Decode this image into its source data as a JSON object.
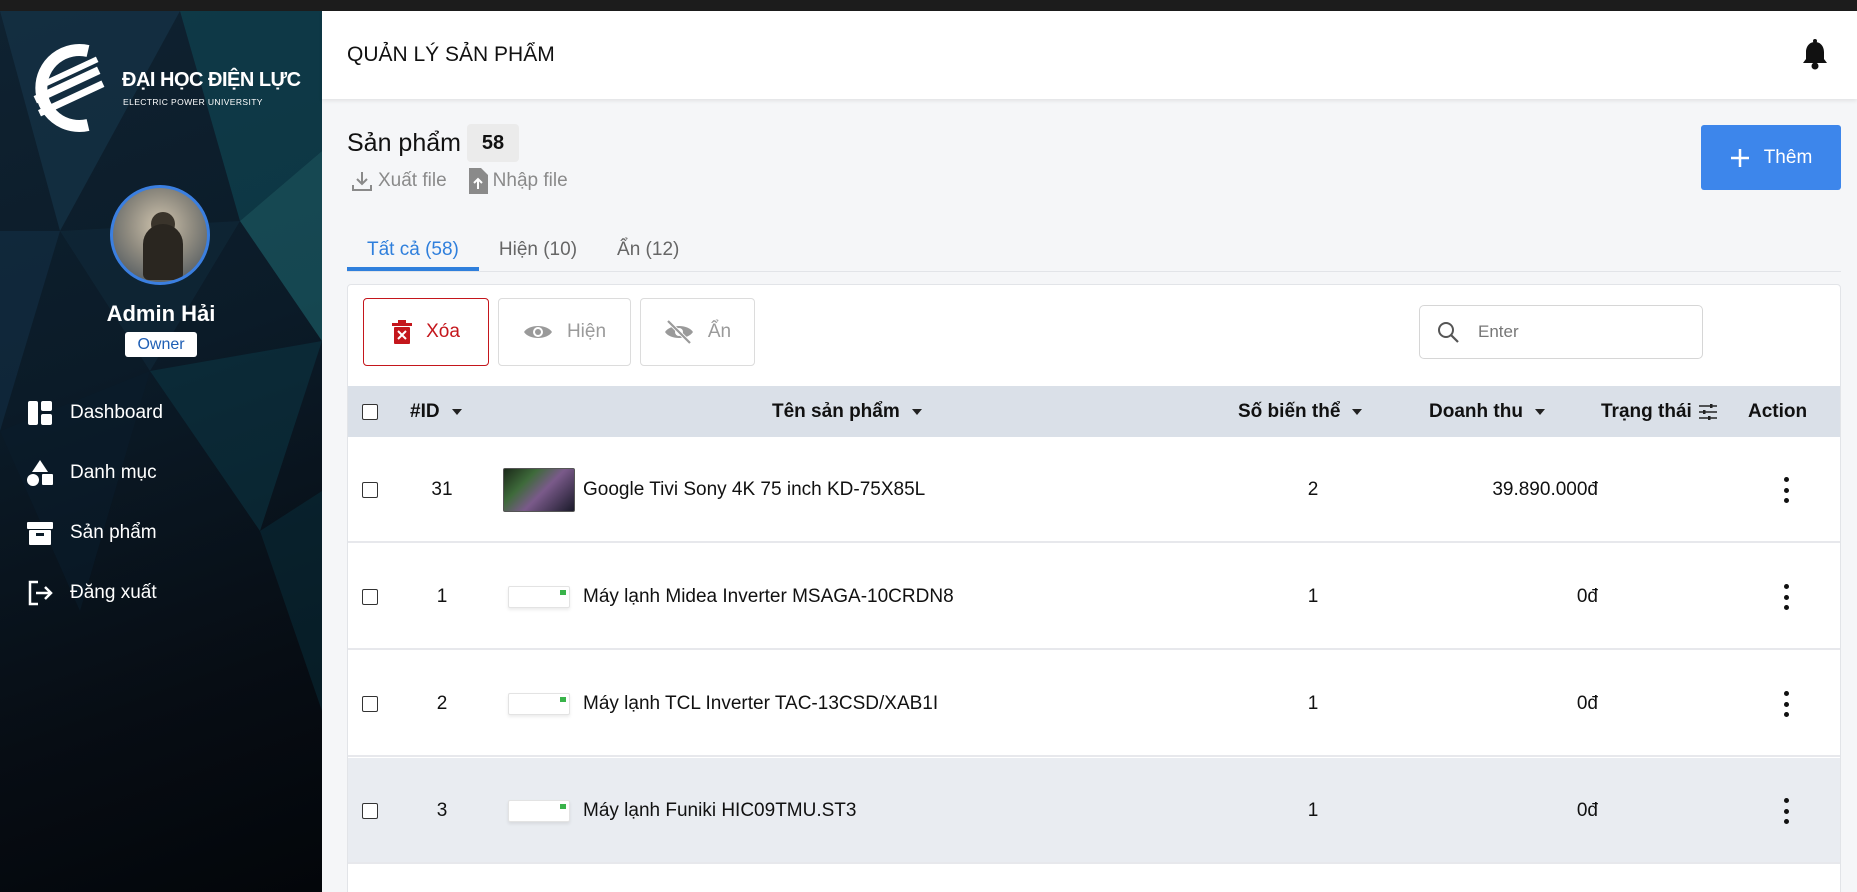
{
  "sidebar": {
    "logo_line1": "ĐẠI HỌC ĐIỆN LỰC",
    "logo_line2": "ELECTRIC POWER UNIVERSITY",
    "user_name": "Admin Hải",
    "user_role": "Owner",
    "nav": [
      {
        "label": "Dashboard",
        "icon": "dashboard-icon"
      },
      {
        "label": "Danh mục",
        "icon": "shapes-icon"
      },
      {
        "label": "Sản phẩm",
        "icon": "archive-icon"
      },
      {
        "label": "Đăng xuất",
        "icon": "logout-icon"
      }
    ]
  },
  "header": {
    "title": "QUẢN LÝ SẢN PHẨM",
    "notification_icon": "bell-icon"
  },
  "page": {
    "title": "Sản phẩm",
    "count": "58",
    "export_label": "Xuất file",
    "import_label": "Nhập file",
    "add_label": "Thêm"
  },
  "tabs": [
    {
      "label": "Tất cả (58)",
      "active": true
    },
    {
      "label": "Hiện (10)",
      "active": false
    },
    {
      "label": "Ẩn (12)",
      "active": false
    }
  ],
  "toolbar": {
    "delete_label": "Xóa",
    "show_label": "Hiện",
    "hide_label": "Ẩn",
    "search_placeholder": "Enter"
  },
  "table": {
    "columns": {
      "id": "#ID",
      "name": "Tên sản phẩm",
      "variants": "Số biến thể",
      "revenue": "Doanh thu",
      "status": "Trạng thái",
      "action": "Action"
    },
    "rows": [
      {
        "id": "31",
        "name": "Google Tivi Sony 4K 75 inch KD-75X85L",
        "variants": "2",
        "revenue": "39.890.000đ",
        "thumb": "tv"
      },
      {
        "id": "1",
        "name": "Máy lạnh Midea Inverter MSAGA-10CRDN8",
        "variants": "1",
        "revenue": "0đ",
        "thumb": "ac"
      },
      {
        "id": "2",
        "name": "Máy lạnh TCL Inverter TAC-13CSD/XAB1I",
        "variants": "1",
        "revenue": "0đ",
        "thumb": "ac"
      },
      {
        "id": "3",
        "name": "Máy lạnh Funiki HIC09TMU.ST3",
        "variants": "1",
        "revenue": "0đ",
        "thumb": "ac"
      }
    ]
  },
  "colors": {
    "accent": "#3d86eb",
    "danger": "#c4161c",
    "table_header": "#dae0e8"
  }
}
